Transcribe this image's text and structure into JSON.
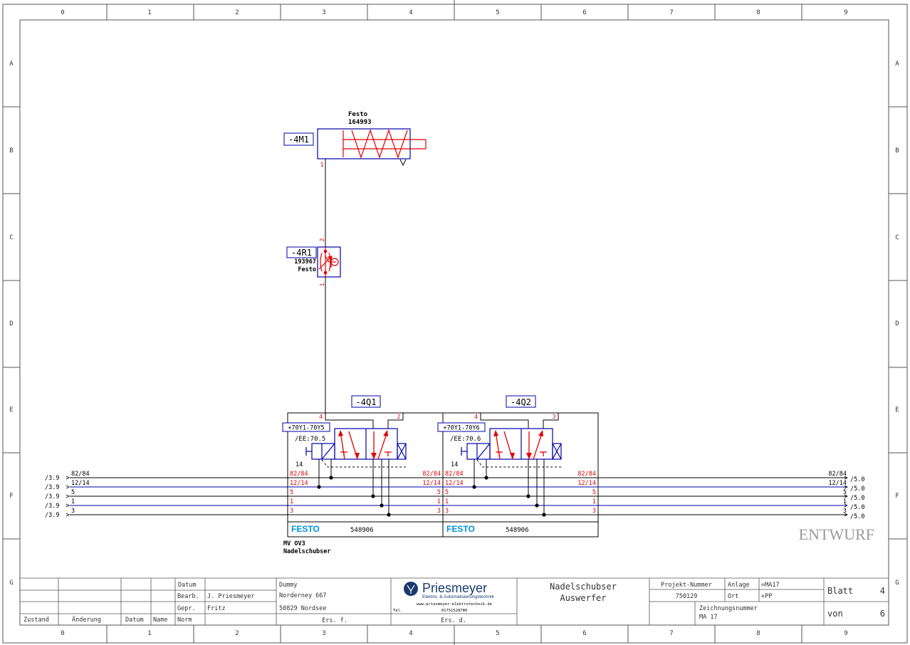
{
  "colors": {
    "frame": "#555555",
    "black": "#000000",
    "blue": "#0000aa",
    "red": "#e00000",
    "festo_blue": "#0091dc",
    "logo_blue": "#1a3a6e",
    "watermark": "#9a9a9a"
  },
  "grid": {
    "columns": [
      "0",
      "1",
      "2",
      "3",
      "4",
      "5",
      "6",
      "7",
      "8",
      "9"
    ],
    "rows": [
      "A",
      "B",
      "C",
      "D",
      "E",
      "F",
      "G"
    ]
  },
  "components": {
    "m1": {
      "tag": "-4M1",
      "maker": "Festo",
      "part": "164993",
      "port": "1"
    },
    "r1": {
      "tag": "-4R1",
      "part": "193967",
      "maker": "Festo",
      "port_top": "2",
      "port_bottom": "1"
    },
    "q1": {
      "tag": "-4Q1",
      "ref": "+70Y1-70Y5",
      "ee": "/EE:70.5",
      "pilot": "14",
      "port_a": "4",
      "port_b": "2",
      "brand": "FESTO",
      "part": "548906"
    },
    "q2": {
      "tag": "-4Q2",
      "ref": "+70Y1-70Y6",
      "ee": "/EE:70.6",
      "pilot": "14",
      "port_a": "4",
      "port_b": "3",
      "brand": "FESTO",
      "part": "548906"
    },
    "block_caption": {
      "line1": "MV OV3",
      "line2": "Nadelschubser"
    }
  },
  "bus": {
    "names": [
      "82/84",
      "12/14",
      "5",
      "1",
      "3"
    ],
    "left_refs": [
      "/3.9",
      "/3.9",
      "/3.9",
      "/3.9",
      "/3.9"
    ],
    "right_refs": [
      "/5.0",
      "/5.0",
      "/5.0",
      "/5.0",
      "/5.0"
    ]
  },
  "watermark": "ENTWURF",
  "title_block": {
    "revision": {
      "zustand": "Zustand",
      "aenderung": "Änderung",
      "datum": "Datum",
      "name": "Name",
      "norm": "Norm"
    },
    "labels": {
      "datum": "Datum",
      "bearb": "Bearb.",
      "gepr": "Gepr."
    },
    "bearb_name": "J. Priesmeyer",
    "gepr_name": "Fritz",
    "customer": {
      "line1": "Dummy",
      "line2": "Norderney 667",
      "line3": "50829  Nordsee",
      "ers_f": "Ers. f."
    },
    "company": {
      "name": "Priesmeyer",
      "tagline": "Elektro- & Automatisierungstechnik",
      "web": "www.priesmeyer-elektrotechnik.de",
      "tel_label": "Tel.",
      "tel": "01751528780",
      "ers_d": "Ers. d."
    },
    "drawing_title": {
      "line1": "Nadelschubser",
      "line2": "Auswerfer"
    },
    "project": {
      "label": "Projekt-Nummer",
      "value": "750129"
    },
    "anlage": {
      "label": "Anlage",
      "value": "=MA17"
    },
    "ort": {
      "label": "Ort",
      "value": "+PP"
    },
    "zeichnung": {
      "label": "Zeichnungsnummer",
      "value": "MA 17"
    },
    "blatt": {
      "label": "Blatt",
      "value": "4"
    },
    "von": {
      "label": "von",
      "value": "6"
    }
  }
}
